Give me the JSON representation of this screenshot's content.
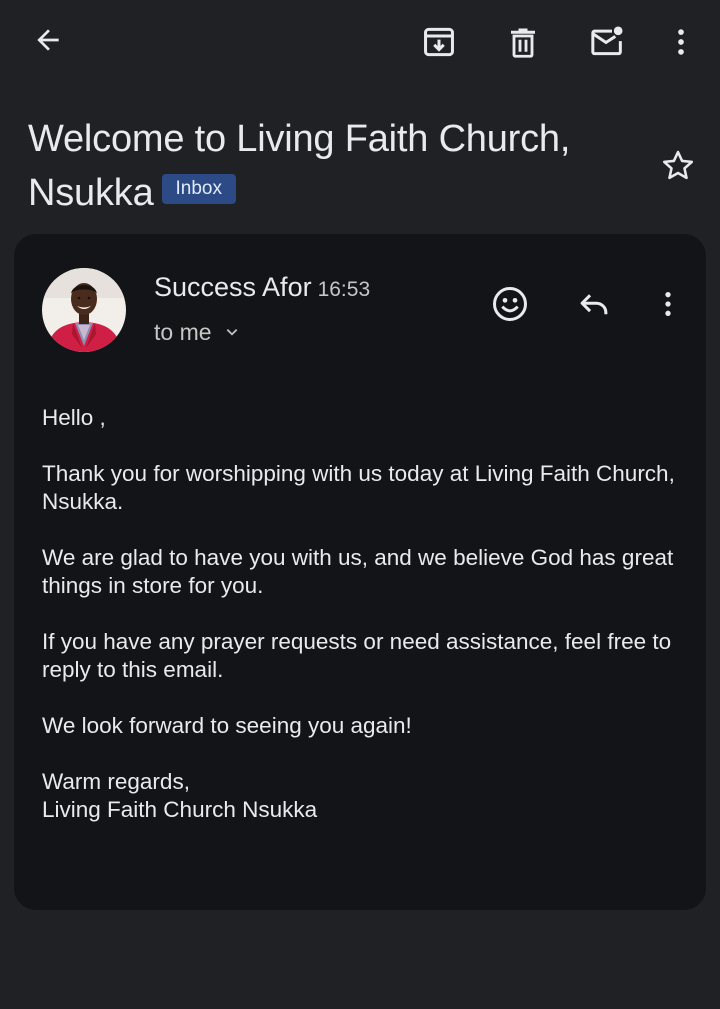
{
  "toolbar": {
    "back_icon": "arrow-left-icon",
    "archive_icon": "archive-icon",
    "delete_icon": "trash-icon",
    "mark_unread_icon": "mark-unread-icon",
    "more_icon": "more-vert-icon"
  },
  "email": {
    "subject": "Welcome to Living Faith Church, Nsukka",
    "label": "Inbox",
    "sender_name": "Success Afor",
    "time": "16:53",
    "recipient": "to me",
    "greeting": "Hello ,",
    "paragraphs": [
      "Thank you for worshipping with us today at Living Faith Church, Nsukka.",
      "We are glad to have you with us, and we believe God has great things in store for you.",
      "If you have any prayer requests or need assistance, feel free to reply to this email.",
      "We look forward to seeing you again!"
    ],
    "signoff": "Warm regards,",
    "signature": "Living Faith Church Nsukka"
  },
  "colors": {
    "background": "#202124",
    "card": "#131418",
    "badge": "#2b4a86",
    "text": "#e8eaed"
  }
}
